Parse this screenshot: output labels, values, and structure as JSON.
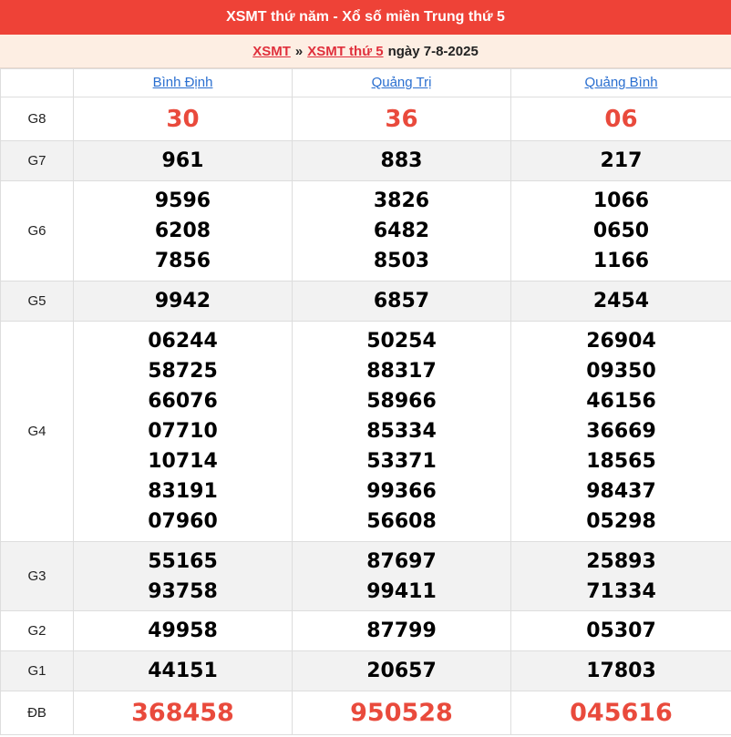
{
  "header": {
    "title": "XSMT thứ năm - Xổ số miền Trung thứ 5"
  },
  "breadcrumb": {
    "link1": "XSMT",
    "sep": "»",
    "link2": "XSMT thứ 5",
    "date_text": "ngày 7-8-2025"
  },
  "provinces": [
    "Bình Định",
    "Quảng Trị",
    "Quảng Bình"
  ],
  "prizes": {
    "g8": {
      "label": "G8",
      "values": [
        [
          "30"
        ],
        [
          "36"
        ],
        [
          "06"
        ]
      ]
    },
    "g7": {
      "label": "G7",
      "values": [
        [
          "961"
        ],
        [
          "883"
        ],
        [
          "217"
        ]
      ]
    },
    "g6": {
      "label": "G6",
      "values": [
        [
          "9596",
          "6208",
          "7856"
        ],
        [
          "3826",
          "6482",
          "8503"
        ],
        [
          "1066",
          "0650",
          "1166"
        ]
      ]
    },
    "g5": {
      "label": "G5",
      "values": [
        [
          "9942"
        ],
        [
          "6857"
        ],
        [
          "2454"
        ]
      ]
    },
    "g4": {
      "label": "G4",
      "values": [
        [
          "06244",
          "58725",
          "66076",
          "07710",
          "10714",
          "83191",
          "07960"
        ],
        [
          "50254",
          "88317",
          "58966",
          "85334",
          "53371",
          "99366",
          "56608"
        ],
        [
          "26904",
          "09350",
          "46156",
          "36669",
          "18565",
          "98437",
          "05298"
        ]
      ]
    },
    "g3": {
      "label": "G3",
      "values": [
        [
          "55165",
          "93758"
        ],
        [
          "87697",
          "99411"
        ],
        [
          "25893",
          "71334"
        ]
      ]
    },
    "g2": {
      "label": "G2",
      "values": [
        [
          "49958"
        ],
        [
          "87799"
        ],
        [
          "05307"
        ]
      ]
    },
    "g1": {
      "label": "G1",
      "values": [
        [
          "44151"
        ],
        [
          "20657"
        ],
        [
          "17803"
        ]
      ]
    },
    "db": {
      "label": "ĐB",
      "values": [
        [
          "368458"
        ],
        [
          "950528"
        ],
        [
          "045616"
        ]
      ]
    }
  }
}
